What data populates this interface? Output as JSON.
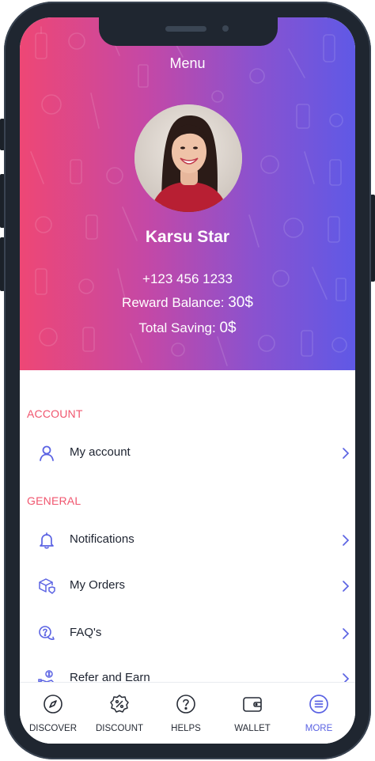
{
  "header": {
    "title": "Menu"
  },
  "profile": {
    "name": "Karsu Star",
    "phone": "+123 456 1233",
    "reward_label": "Reward Balance: ",
    "reward_value": "30$",
    "saving_label": "Total Saving: ",
    "saving_value": "0$"
  },
  "sections": {
    "account": {
      "title": "ACCOUNT",
      "items": [
        {
          "label": "My account",
          "icon": "user-icon"
        }
      ]
    },
    "general": {
      "title": "GENERAL",
      "items": [
        {
          "label": "Notifications",
          "icon": "bell-icon"
        },
        {
          "label": "My Orders",
          "icon": "box-icon"
        },
        {
          "label": "FAQ's",
          "icon": "question-bubble-icon"
        },
        {
          "label": "Refer and Earn",
          "icon": "refer-icon"
        }
      ]
    }
  },
  "tabbar": {
    "items": [
      {
        "label": "DISCOVER",
        "icon": "compass-icon"
      },
      {
        "label": "DISCOUNT",
        "icon": "discount-icon"
      },
      {
        "label": "HELPS",
        "icon": "help-icon"
      },
      {
        "label": "WALLET",
        "icon": "wallet-icon"
      },
      {
        "label": "MORE",
        "icon": "menu-icon",
        "active": true
      }
    ]
  },
  "colors": {
    "accent": "#5b63e3",
    "section_label": "#f0556e",
    "gradient_start": "#ee4775",
    "gradient_end": "#5f59e6"
  }
}
